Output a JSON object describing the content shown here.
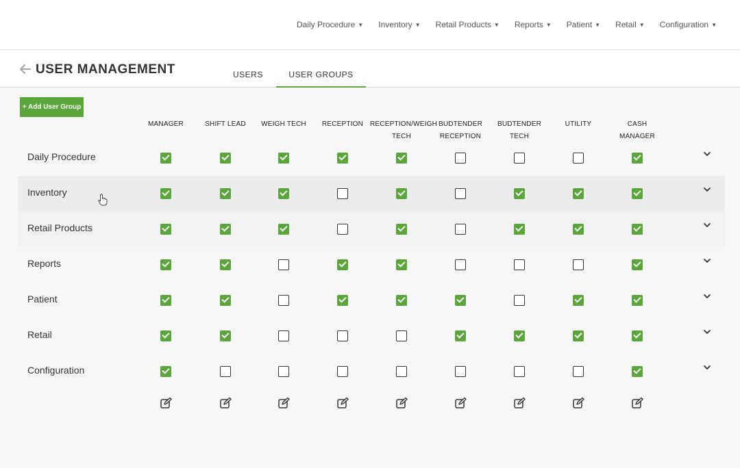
{
  "nav": {
    "items": [
      {
        "label": "Daily Procedure"
      },
      {
        "label": "Inventory"
      },
      {
        "label": "Retail Products"
      },
      {
        "label": "Reports"
      },
      {
        "label": "Patient"
      },
      {
        "label": "Retail"
      },
      {
        "label": "Configuration"
      }
    ]
  },
  "header": {
    "title": "USER MANAGEMENT",
    "tabs": [
      {
        "label": "USERS",
        "active": false
      },
      {
        "label": "USER GROUPS",
        "active": true
      }
    ]
  },
  "add_button_label": "+ Add User Group",
  "columns": [
    {
      "line1": "MANAGER",
      "line2": ""
    },
    {
      "line1": "SHIFT LEAD",
      "line2": ""
    },
    {
      "line1": "WEIGH TECH",
      "line2": ""
    },
    {
      "line1": "RECEPTION",
      "line2": ""
    },
    {
      "line1": "RECEPTION/WEIGH",
      "line2": "TECH"
    },
    {
      "line1": "BUDTENDER",
      "line2": "RECEPTION"
    },
    {
      "line1": "BUDTENDER",
      "line2": "TECH"
    },
    {
      "line1": "UTILITY",
      "line2": ""
    },
    {
      "line1": "CASH",
      "line2": "MANAGER"
    }
  ],
  "rows": [
    {
      "label": "Daily Procedure",
      "checks": [
        true,
        true,
        true,
        true,
        true,
        false,
        false,
        false,
        true
      ]
    },
    {
      "label": "Inventory",
      "checks": [
        true,
        true,
        true,
        false,
        true,
        false,
        true,
        true,
        true
      ]
    },
    {
      "label": "Retail Products",
      "checks": [
        true,
        true,
        true,
        false,
        true,
        false,
        true,
        true,
        true
      ]
    },
    {
      "label": "Reports",
      "checks": [
        true,
        true,
        false,
        true,
        true,
        false,
        false,
        false,
        true
      ]
    },
    {
      "label": "Patient",
      "checks": [
        true,
        true,
        false,
        true,
        true,
        true,
        false,
        true,
        true
      ]
    },
    {
      "label": "Retail",
      "checks": [
        true,
        true,
        false,
        false,
        false,
        true,
        true,
        true,
        true
      ]
    },
    {
      "label": "Configuration",
      "checks": [
        true,
        false,
        false,
        false,
        false,
        false,
        false,
        false,
        true
      ]
    }
  ],
  "colors": {
    "accent": "#5ba63a"
  },
  "icons": {
    "back": "arrow-left-icon",
    "expand": "chevron-down-icon",
    "edit": "edit-icon"
  }
}
